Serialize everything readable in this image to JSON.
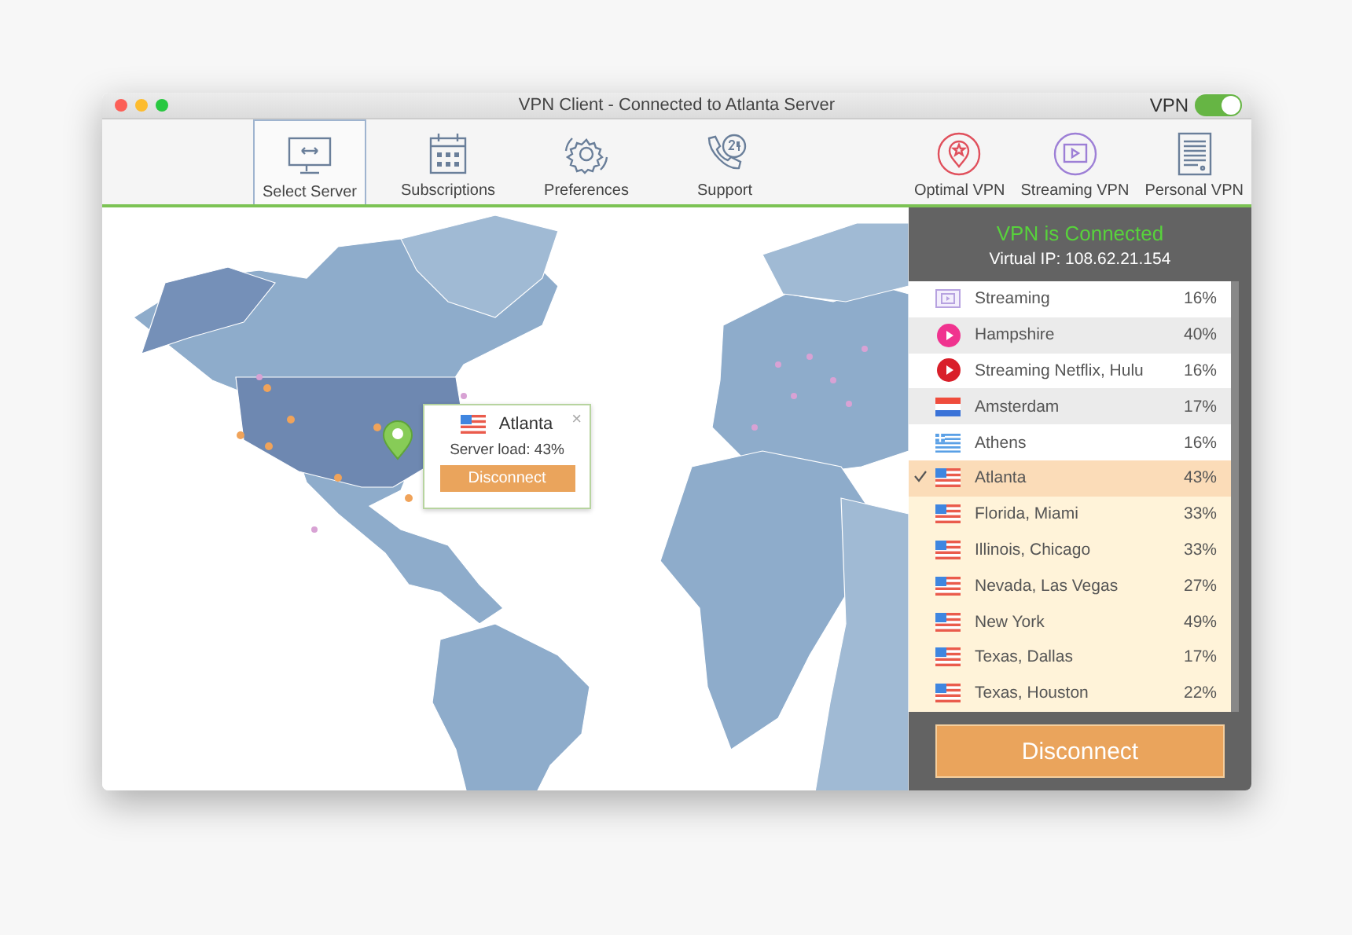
{
  "window": {
    "title": "VPN Client - Connected to Atlanta Server"
  },
  "vpn_toggle": {
    "label": "VPN",
    "on": true
  },
  "toolbar": {
    "left": [
      {
        "label": "Select Server",
        "kind": "monitor",
        "selected": true
      },
      {
        "label": "Subscriptions",
        "kind": "calendar",
        "selected": false
      },
      {
        "label": "Preferences",
        "kind": "gear",
        "selected": false
      },
      {
        "label": "Support",
        "kind": "phone",
        "selected": false
      }
    ],
    "right": [
      {
        "label": "Optimal VPN",
        "kind": "optimal"
      },
      {
        "label": "Streaming VPN",
        "kind": "streaming"
      },
      {
        "label": "Personal VPN",
        "kind": "server"
      }
    ]
  },
  "map_popup": {
    "city": "Atlanta",
    "close": "×",
    "load": "Server load: 43%",
    "button": "Disconnect"
  },
  "panel": {
    "status": "VPN is Connected",
    "ip": "Virtual IP: 108.62.21.154",
    "servers": [
      {
        "name": "Streaming",
        "load": "16%",
        "kind": "stream-box",
        "color": "#ffffff",
        "selected": false
      },
      {
        "name": "Hampshire",
        "load": "40%",
        "kind": "pink-play",
        "color": "#ebebeb",
        "selected": false
      },
      {
        "name": "Streaming Netflix, Hulu",
        "load": "16%",
        "kind": "red-play",
        "color": "#ffffff",
        "selected": false
      },
      {
        "name": "Amsterdam",
        "load": "17%",
        "kind": "flag-nl",
        "color": "#ebebeb",
        "selected": false
      },
      {
        "name": "Athens",
        "load": "16%",
        "kind": "flag-gr",
        "color": "#ffffff",
        "selected": false
      },
      {
        "name": "Atlanta",
        "load": "43%",
        "kind": "flag-us",
        "color": "#fbdcb8",
        "selected": true
      },
      {
        "name": "Florida, Miami",
        "load": "33%",
        "kind": "flag-us",
        "color": "#fff3d9",
        "selected": false
      },
      {
        "name": "Illinois, Chicago",
        "load": "33%",
        "kind": "flag-us",
        "color": "#fff3d9",
        "selected": false
      },
      {
        "name": "Nevada, Las Vegas",
        "load": "27%",
        "kind": "flag-us",
        "color": "#fff3d9",
        "selected": false
      },
      {
        "name": "New York",
        "load": "49%",
        "kind": "flag-us",
        "color": "#fff3d9",
        "selected": false
      },
      {
        "name": "Texas, Dallas",
        "load": "17%",
        "kind": "flag-us",
        "color": "#fff3d9",
        "selected": false
      },
      {
        "name": "Texas, Houston",
        "load": "22%",
        "kind": "flag-us",
        "color": "#fff3d9",
        "selected": false
      }
    ],
    "button": "Disconnect"
  }
}
